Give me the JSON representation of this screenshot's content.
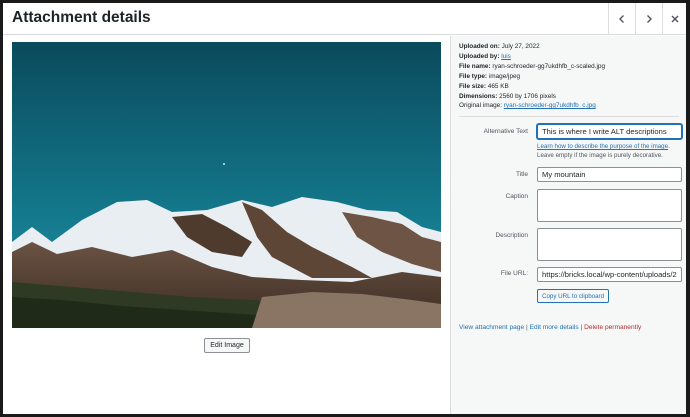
{
  "header": {
    "title": "Attachment details",
    "prev_icon": "chevron-left-icon",
    "next_icon": "chevron-right-icon",
    "close_icon": "close-icon"
  },
  "preview": {
    "edit_button_label": "Edit Image"
  },
  "meta": {
    "uploaded_on_label": "Uploaded on:",
    "uploaded_on": "July 27, 2022",
    "uploaded_by_label": "Uploaded by:",
    "uploaded_by": "luis",
    "file_name_label": "File name:",
    "file_name": "ryan-schroeder-gg7ukdhfb_c-scaled.jpg",
    "file_type_label": "File type:",
    "file_type": "image/jpeg",
    "file_size_label": "File size:",
    "file_size": "465 KB",
    "dimensions_label": "Dimensions:",
    "dimensions": "2560 by 1706 pixels",
    "original_label": "Original image:",
    "original": "ryan-schroeder-gg7ukdhfb_c.jpg"
  },
  "form": {
    "alt_label": "Alternative Text",
    "alt_value": "This is where I write ALT descriptions",
    "alt_help_link": "Learn how to describe the purpose of the image",
    "alt_help_text": "Leave empty if the image is purely decorative.",
    "title_label": "Title",
    "title_value": "My mountain",
    "caption_label": "Caption",
    "caption_value": "",
    "description_label": "Description",
    "description_value": "",
    "url_label": "File URL:",
    "url_value": "https://bricks.local/wp-content/uploads/2",
    "copy_label": "Copy URL to clipboard"
  },
  "actions": {
    "view_label": "View attachment page",
    "edit_label": "Edit more details",
    "delete_label": "Delete permanently",
    "separator": "|"
  },
  "colors": {
    "link": "#2271b1",
    "danger": "#b32d2e",
    "panel_bg": "#f6f7f7"
  }
}
